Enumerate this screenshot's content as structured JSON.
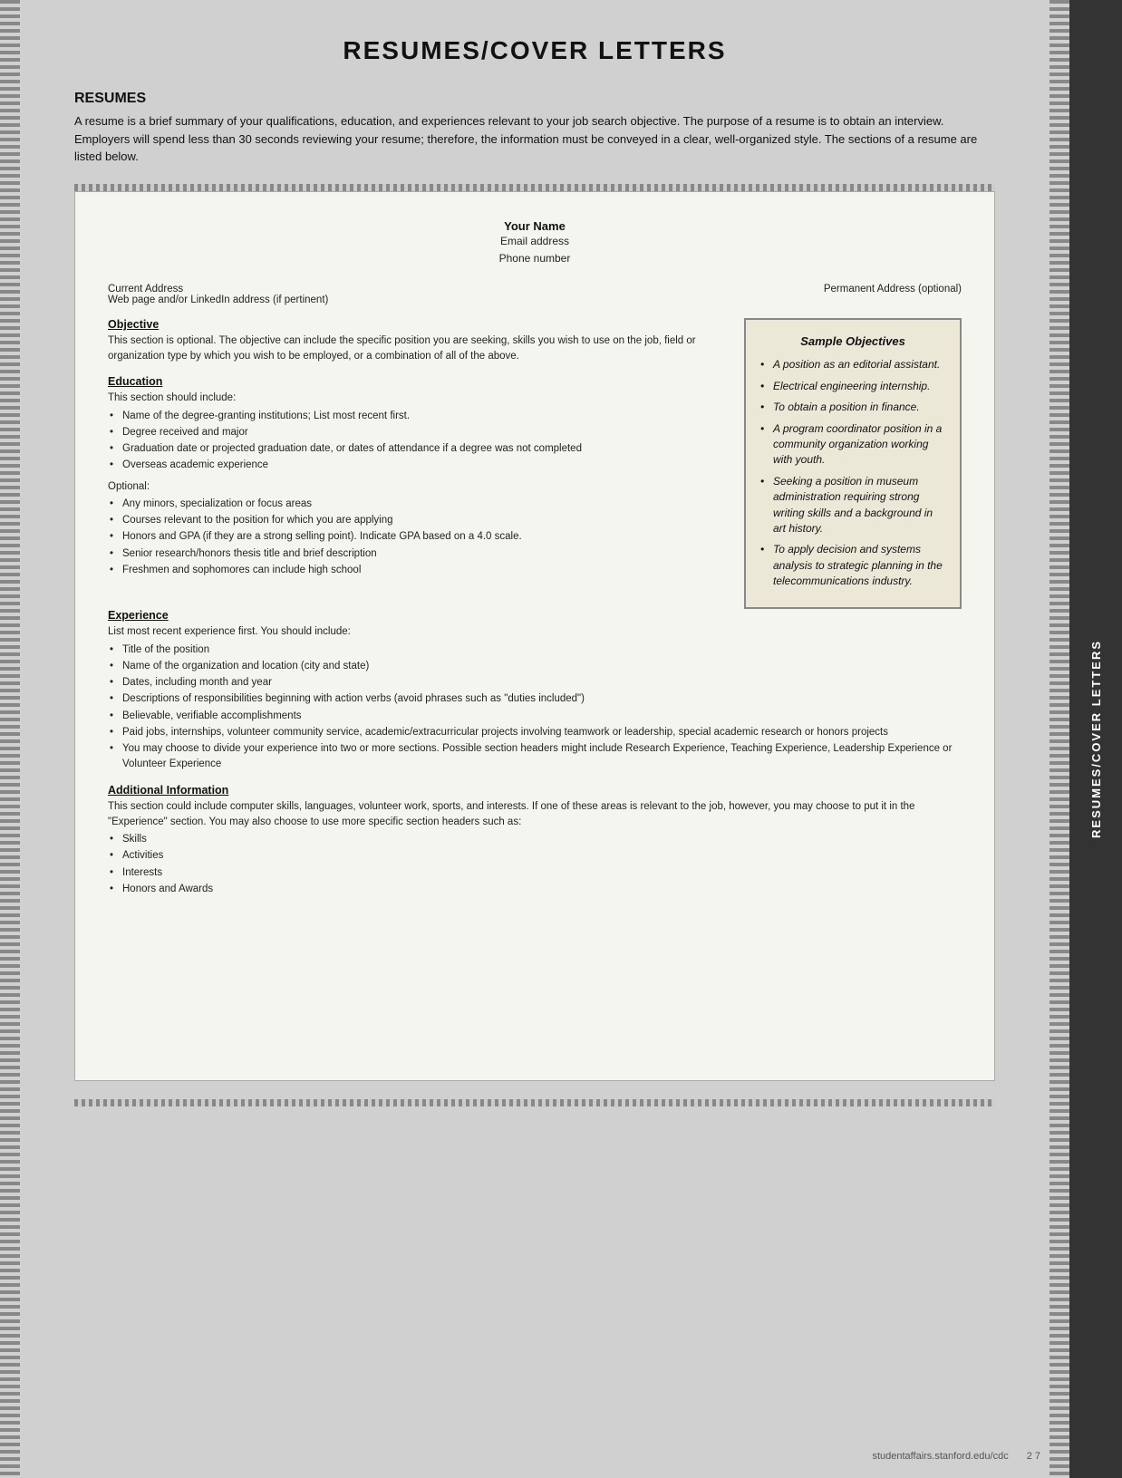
{
  "page": {
    "title": "RESUMES/COVER LETTERS",
    "section": "RESUMES",
    "intro": "A resume is a brief summary of your qualifications, education, and experiences relevant to your job search objective. The purpose of a resume is to obtain an interview. Employers will spend less than 30 seconds reviewing your resume; therefore, the information must be conveyed in a clear, well-organized style. The sections of a resume are listed below.",
    "footer_url": "studentaffairs.stanford.edu/cdc",
    "footer_page": "2  7"
  },
  "resume_template": {
    "name": "Your Name",
    "email": "Email address",
    "phone": "Phone number",
    "current_address_label": "Current Address",
    "current_address_sub": "Web page and/or LinkedIn address (if pertinent)",
    "permanent_address_label": "Permanent Address (optional)"
  },
  "sections": {
    "objective": {
      "title": "Objective",
      "text": "This section is optional. The objective can include the specific position you are seeking, skills you wish to use on the job, field or organization type by which you wish to be employed, or a combination of all of the above."
    },
    "education": {
      "title": "Education",
      "intro": "This section should include:",
      "bullets": [
        "Name of the degree-granting institutions; List most recent first.",
        "Degree received and major",
        "Graduation date or projected graduation date, or dates of attendance if a degree was not completed",
        "Overseas academic experience"
      ],
      "optional_label": "Optional:",
      "optional_bullets": [
        "Any minors, specialization or focus areas",
        "Courses relevant to the position for which you are applying",
        "Honors and GPA (if they are a strong selling point). Indicate GPA based on a 4.0 scale.",
        "Senior research/honors thesis title and brief description",
        "Freshmen and sophomores can include high school"
      ]
    },
    "experience": {
      "title": "Experience",
      "intro": "List most recent experience first. You should include:",
      "bullets": [
        "Title of the position",
        "Name of the organization and location (city and state)",
        "Dates, including month and year",
        "Descriptions of responsibilities beginning with action verbs (avoid phrases such as \"duties included\")",
        "Believable, verifiable accomplishments",
        "Paid jobs, internships, volunteer community service, academic/extracurricular projects involving teamwork or leadership, special academic research or honors projects",
        "You may choose to divide your experience into two or more sections. Possible section headers might include Research Experience, Teaching Experience, Leadership Experience or Volunteer Experience"
      ]
    },
    "additional": {
      "title": "Additional Information",
      "text": "This section could include computer skills, languages, volunteer work, sports, and interests. If one of these areas is relevant to the job, however, you may choose to put it in the \"Experience\" section. You may also choose to use more specific section headers such as:",
      "bullets": [
        "Skills",
        "Activities",
        "Interests",
        "Honors and Awards"
      ]
    }
  },
  "sample_objectives": {
    "title": "Sample Objectives",
    "items": [
      "A position as an editorial assistant.",
      "Electrical engineering internship.",
      "To obtain a position in finance.",
      "A program coordinator position in a community organization working with youth.",
      "Seeking a position in museum administration requiring strong writing skills and a background in art history.",
      "To apply decision and systems analysis to strategic planning in the telecommunications industry."
    ]
  },
  "sidebar_label": "RESUMES/COVER LETTERS"
}
